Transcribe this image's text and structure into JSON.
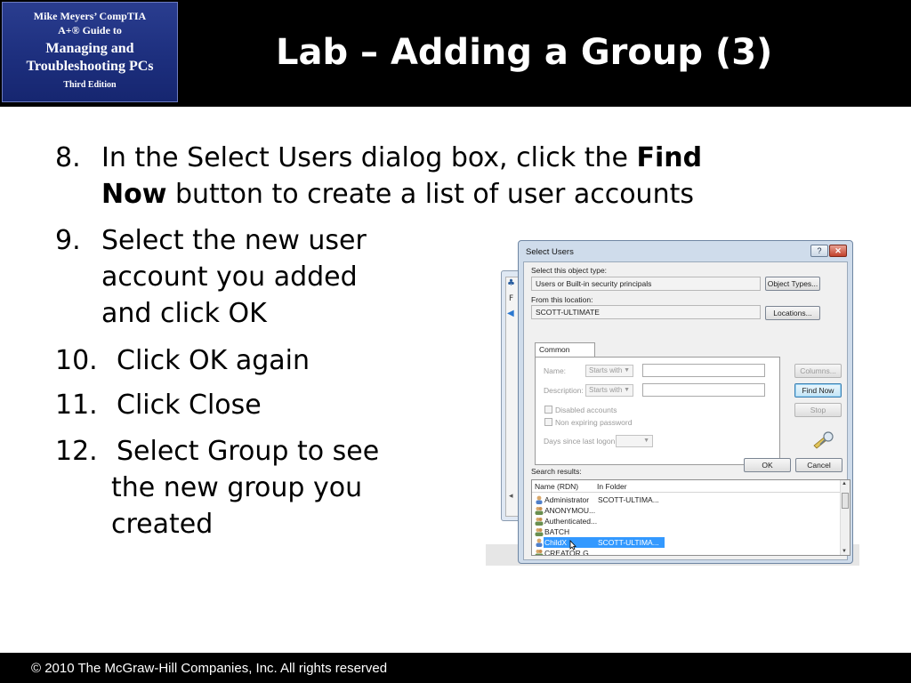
{
  "header": {
    "book_logo": {
      "line1": "Mike Meyers’ CompTIA",
      "line2": "A+® Guide to",
      "line3": "Managing and",
      "line4": "Troubleshooting PCs",
      "line5": "Third Edition"
    },
    "title": "Lab – Adding a Group (3)"
  },
  "steps": [
    {
      "number": "8.",
      "lines": [
        "In the Select Users dialog box, click the",
        "Find",
        "Now",
        "button to create a list of user accounts"
      ]
    },
    {
      "number": "9.",
      "lines": [
        "Select the new user",
        "account you added",
        "and click OK"
      ]
    },
    {
      "number": "10.",
      "text": "Click OK again"
    },
    {
      "number": "11.",
      "text": "Click Close"
    },
    {
      "number": "12.",
      "lines": [
        "Select Group to see",
        "the new group you",
        "created"
      ]
    }
  ],
  "footer": {
    "copyright": "© 2010 The McGraw-Hill Companies, Inc. All rights reserved"
  },
  "dialog": {
    "title": "Select Users",
    "help_glyph": "?",
    "close_glyph": "✕",
    "object_type_label": "Select this object type:",
    "object_type_value": "Users or Built-in security principals",
    "object_types_button": "Object Types...",
    "location_label": "From this location:",
    "location_value": "SCOTT-ULTIMATE",
    "locations_button": "Locations...",
    "tab_label": "Common Queries",
    "name_label": "Name:",
    "name_operator": "Starts with",
    "description_label": "Description:",
    "description_operator": "Starts with",
    "disabled_accounts_label": "Disabled accounts",
    "non_expiring_password_label": "Non expiring password",
    "days_since_logon_label": "Days since last logon:",
    "columns_button": "Columns...",
    "find_now_button": "Find Now",
    "stop_button": "Stop",
    "search_results_label": "Search results:",
    "ok_button": "OK",
    "cancel_button": "Cancel",
    "results_columns": [
      "Name (RDN)",
      "In Folder"
    ],
    "results_rows": [
      {
        "name": "Administrator",
        "folder": "SCOTT-ULTIMA..."
      },
      {
        "name": "ANONYMOU...",
        "folder": ""
      },
      {
        "name": "Authenticated...",
        "folder": ""
      },
      {
        "name": "BATCH",
        "folder": ""
      },
      {
        "name": "ChildX",
        "folder": "SCOTT-ULTIMA...",
        "selected": true
      },
      {
        "name": "CREATOR G...",
        "folder": ""
      }
    ]
  },
  "colors": {
    "header_bg": "#000000",
    "logo_bg": "#1d2f7e",
    "selection_blue": "#3399ff"
  }
}
